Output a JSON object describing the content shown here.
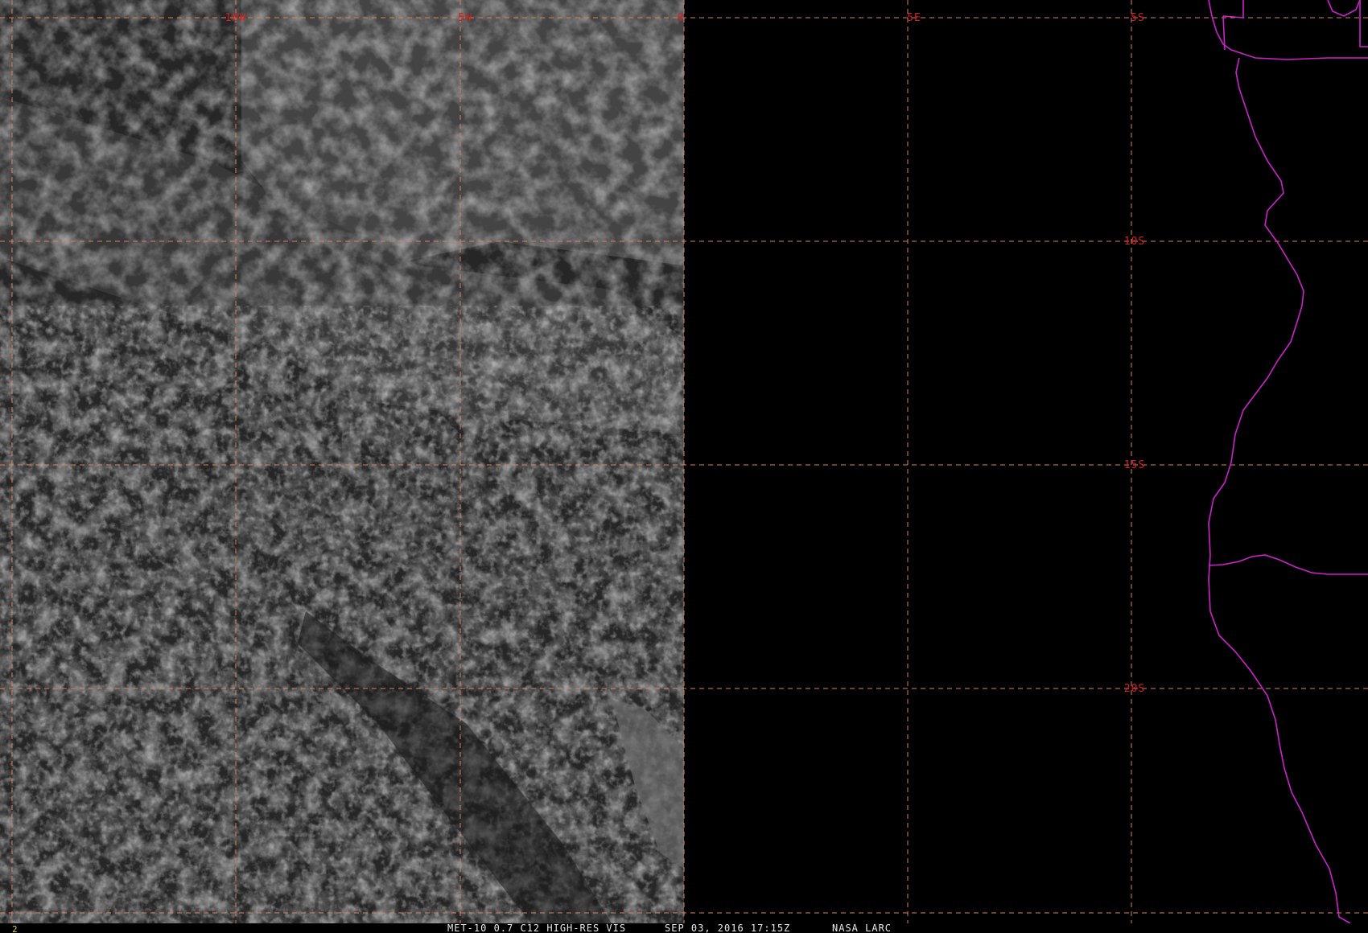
{
  "map": {
    "satellite_colors": {
      "background": "#000000",
      "imagery_base": "#2a2a2a",
      "cloud_bright": "#8a8a8a",
      "grid_line": "#d9825a",
      "grid_label": "#d42020",
      "coastline": "#cc22cc",
      "panel_number": "#e0d020",
      "footer_text": "#e8e8e8"
    },
    "longitude_labels": [
      "10W",
      "5W",
      "0",
      "5E"
    ],
    "latitude_labels": [
      "5S",
      "10S",
      "15S",
      "20S"
    ],
    "footer": {
      "panel_number": "2",
      "product": "MET-10 0.7 C12 HIGH-RES VIS",
      "datetime": "SEP 03, 2016 17:15Z",
      "source": "NASA LARC"
    }
  }
}
